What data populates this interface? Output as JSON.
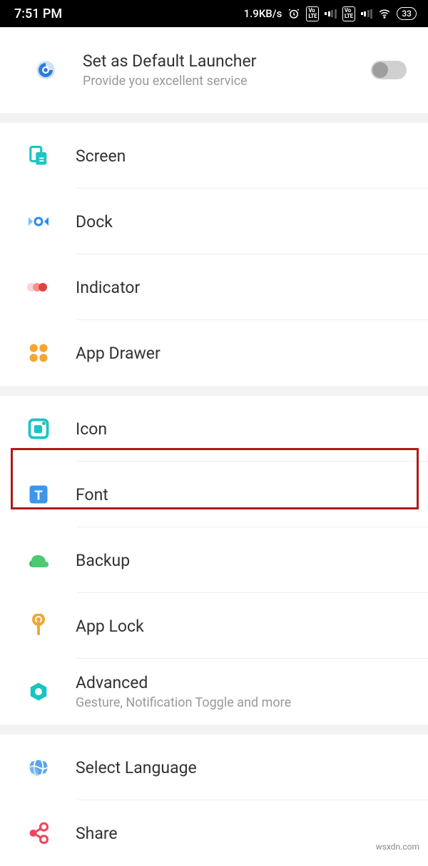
{
  "statusbar": {
    "time": "7:51 PM",
    "net_speed": "1.9KB/s",
    "battery": "33"
  },
  "header": {
    "title": "Set as Default Launcher",
    "subtitle": "Provide you excellent service"
  },
  "group1": [
    {
      "id": "screen",
      "label": "Screen"
    },
    {
      "id": "dock",
      "label": "Dock"
    },
    {
      "id": "indicator",
      "label": "Indicator"
    },
    {
      "id": "appdrawer",
      "label": "App Drawer"
    }
  ],
  "group2": [
    {
      "id": "icon",
      "label": "Icon"
    },
    {
      "id": "font",
      "label": "Font"
    },
    {
      "id": "backup",
      "label": "Backup"
    },
    {
      "id": "applock",
      "label": "App Lock"
    },
    {
      "id": "advanced",
      "label": "Advanced",
      "subtitle": "Gesture, Notification Toggle and more"
    }
  ],
  "group3": [
    {
      "id": "language",
      "label": "Select Language"
    },
    {
      "id": "share",
      "label": "Share"
    }
  ],
  "watermark": "wsxdn.com"
}
